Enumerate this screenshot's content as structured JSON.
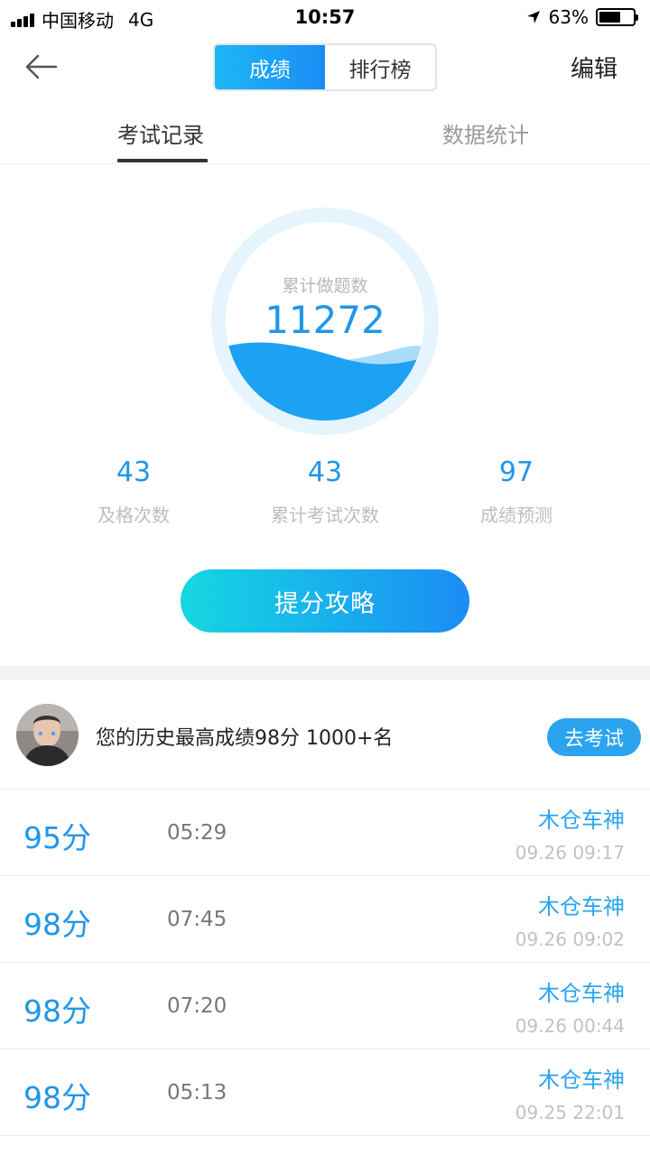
{
  "status_bar": {
    "carrier": "中国移动",
    "network": "4G",
    "time": "10:57",
    "battery_percent": "63%",
    "battery_level": 0.63
  },
  "nav": {
    "back_icon": "arrow-left-icon",
    "segments": [
      {
        "label": "成绩",
        "active": true
      },
      {
        "label": "排行榜",
        "active": false
      }
    ],
    "edit_label": "编辑"
  },
  "sub_tabs": [
    {
      "label": "考试记录",
      "active": true
    },
    {
      "label": "数据统计",
      "active": false
    }
  ],
  "summary": {
    "total_label": "累计做题数",
    "total_value": "11272",
    "stats": [
      {
        "value": "43",
        "label": "及格次数"
      },
      {
        "value": "43",
        "label": "累计考试次数"
      },
      {
        "value": "97",
        "label": "成绩预测"
      }
    ],
    "tips_button": "提分攻略"
  },
  "best": {
    "text": "您的历史最高成绩98分 1000+名",
    "go_exam_button": "去考试"
  },
  "records": [
    {
      "score": "95分",
      "duration": "05:29",
      "name": "木仓车神",
      "time": "09.26 09:17"
    },
    {
      "score": "98分",
      "duration": "07:45",
      "name": "木仓车神",
      "time": "09.26 09:02"
    },
    {
      "score": "98分",
      "duration": "07:20",
      "name": "木仓车神",
      "time": "09.26 00:44"
    },
    {
      "score": "98分",
      "duration": "05:13",
      "name": "木仓车神",
      "time": "09.25 22:01"
    }
  ],
  "colors": {
    "accent": "#2196e8",
    "gradient_start": "#15d7e2",
    "gradient_end": "#1b8cf5"
  }
}
